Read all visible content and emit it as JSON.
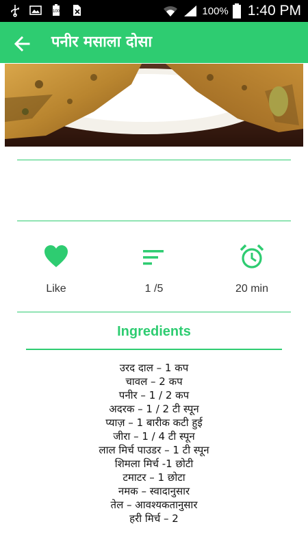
{
  "status_bar": {
    "icons": [
      "usb-icon",
      "image-icon",
      "battery-saver-icon",
      "no-sim-icon",
      "wifi-icon",
      "signal-icon",
      "battery-icon"
    ],
    "battery_percent": "100%",
    "time": "1:40 PM"
  },
  "app_bar": {
    "title": "पनीर मसाला दोसा",
    "back_icon": "arrow-back-icon",
    "color": "#2ecc71"
  },
  "stats": {
    "like": {
      "icon": "heart-icon",
      "label": "Like"
    },
    "rating": {
      "icon": "sort-lines-icon",
      "label": "1 /5"
    },
    "time": {
      "icon": "alarm-clock-icon",
      "label": "20 min"
    }
  },
  "ingredients": {
    "title": "Ingredients",
    "items": [
      "उरद दाल – 1 कप",
      "चावल – 2 कप",
      "पनीर – 1 / 2 कप",
      "अदरक – 1 / 2 टी स्पून",
      "प्याज़ – 1 बारीक कटी हुई",
      "जीरा – 1 / 4 टी स्पून",
      "लाल मिर्च पाउडर – 1 टी स्पून",
      "शिमला मिर्च -1 छोटी",
      "टमाटर – 1 छोटा",
      "नमक – स्वादानुसार",
      "तेल – आवश्यकतानुसार",
      "हरी मिर्च – 2"
    ]
  },
  "colors": {
    "accent": "#2ecc71",
    "status_bar": "#000000"
  }
}
